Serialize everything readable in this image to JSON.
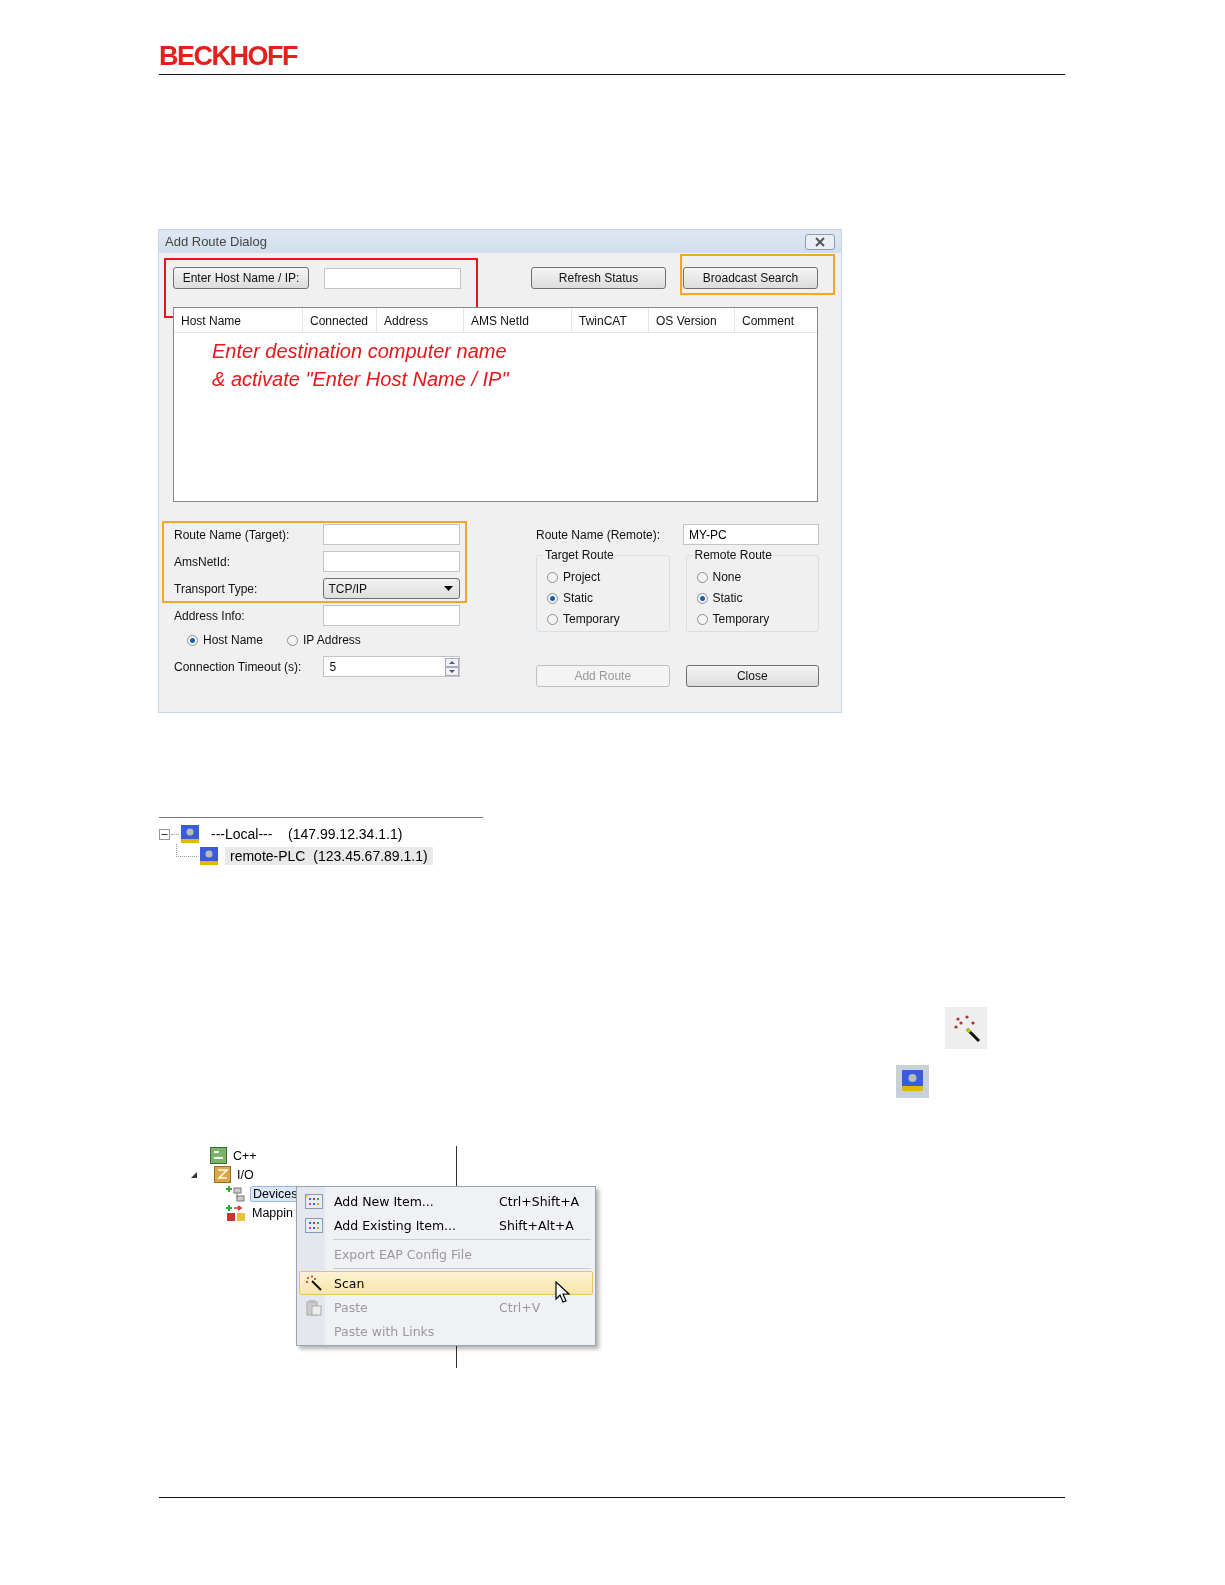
{
  "header": {
    "logo": "BECKHOFF"
  },
  "dialog": {
    "title": "Add Route Dialog",
    "host_button": "Enter Host Name / IP:",
    "refresh_button": "Refresh Status",
    "broadcast_button": "Broadcast Search",
    "columns": [
      "Host Name",
      "Connected",
      "Address",
      "AMS NetId",
      "TwinCAT",
      "OS Version",
      "Comment"
    ],
    "annotation": [
      "Enter destination computer name",
      "& activate \"Enter Host Name / IP\""
    ],
    "route_name_target": {
      "label": "Route Name (Target):"
    },
    "ams_net_id": {
      "label": "AmsNetId:"
    },
    "transport_type": {
      "label": "Transport Type:",
      "value": "TCP/IP"
    },
    "address_info": {
      "label": "Address Info:"
    },
    "address_mode": [
      {
        "label": "Host Name",
        "selected": true
      },
      {
        "label": "IP Address",
        "selected": false
      }
    ],
    "connection_timeout": {
      "label": "Connection Timeout (s):",
      "value": "5"
    },
    "route_name_remote": {
      "label": "Route Name (Remote):",
      "value": "MY-PC"
    },
    "target_route": {
      "title": "Target Route",
      "options": [
        {
          "label": "Project",
          "selected": false
        },
        {
          "label": "Static",
          "selected": true
        },
        {
          "label": "Temporary",
          "selected": false
        }
      ]
    },
    "remote_route": {
      "title": "Remote Route",
      "options": [
        {
          "label": "None",
          "selected": false
        },
        {
          "label": "Static",
          "selected": true
        },
        {
          "label": "Temporary",
          "selected": false
        }
      ]
    },
    "buttons": [
      {
        "label": "Add Route",
        "disabled": true
      },
      {
        "label": "Close",
        "disabled": false
      }
    ]
  },
  "route_tree": [
    {
      "label": "---Local---",
      "address": "(147.99.12.34.1.1)",
      "expanded": true,
      "selected": false,
      "children": [
        {
          "label": "remote-PLC",
          "address": "(123.45.67.89.1.1)",
          "selected": true
        }
      ]
    }
  ],
  "solution_tree": [
    {
      "label": "C++",
      "kind": "cpp",
      "selected": false
    },
    {
      "label": "I/O",
      "kind": "io",
      "expanded": true,
      "selected": false,
      "children": [
        {
          "label": "Devices",
          "kind": "devices",
          "selected": true
        },
        {
          "label": "Mappin",
          "kind": "mappings",
          "selected": false
        }
      ]
    }
  ],
  "context_menu": [
    {
      "kind": "new",
      "label": "Add New Item...",
      "shortcut": "Ctrl+Shift+A",
      "disabled": false,
      "selected": false
    },
    {
      "kind": "existing",
      "label": "Add Existing Item...",
      "shortcut": "Shift+Alt+A",
      "disabled": false,
      "selected": false
    },
    {
      "kind": "separator"
    },
    {
      "kind": "plain",
      "label": "Export EAP Config File",
      "disabled": true,
      "selected": false
    },
    {
      "kind": "separator"
    },
    {
      "kind": "scan",
      "label": "Scan",
      "disabled": false,
      "selected": true
    },
    {
      "kind": "paste",
      "label": "Paste",
      "shortcut": "Ctrl+V",
      "disabled": true,
      "selected": false
    },
    {
      "kind": "plain",
      "label": "Paste with Links",
      "disabled": true,
      "selected": false
    }
  ]
}
